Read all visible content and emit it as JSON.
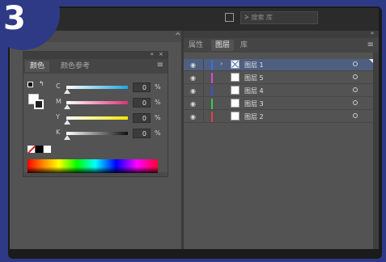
{
  "step_badge": "3",
  "toolbar": {
    "search_placeholder": "ᗒ 搜索 库"
  },
  "left_panel": {
    "collapse_glyph": "^"
  },
  "color_panel": {
    "header_buttons": "« ×",
    "tabs": [
      {
        "label": "颜色",
        "active": true
      },
      {
        "label": "颜色参考",
        "active": false
      }
    ],
    "menu_glyph": "≡",
    "swap_glyph": "↰",
    "sliders": [
      {
        "label": "C",
        "value": "0",
        "unit": "%",
        "fraction": 0.0,
        "color_from": "#ffffff",
        "color_to": "#1ea6e0"
      },
      {
        "label": "M",
        "value": "0",
        "unit": "%",
        "fraction": 0.0,
        "color_from": "#ffffff",
        "color_to": "#e0307a"
      },
      {
        "label": "Y",
        "value": "0",
        "unit": "%",
        "fraction": 0.0,
        "color_from": "#ffffff",
        "color_to": "#f2e600"
      },
      {
        "label": "K",
        "value": "0",
        "unit": "%",
        "fraction": 0.0,
        "color_from": "#ffffff",
        "color_to": "#111111"
      }
    ]
  },
  "layers_panel": {
    "collapse_glyph": "»",
    "tabs": [
      {
        "label": "属性"
      },
      {
        "label": "图层",
        "active": true
      },
      {
        "label": "库"
      }
    ],
    "menu_glyph": "≡",
    "layers": [
      {
        "name": "图层 1",
        "color": "#3b6fd8",
        "selected": true,
        "expanded": true
      },
      {
        "name": "图层 5",
        "color": "#d94ad1",
        "selected": false,
        "expanded": false
      },
      {
        "name": "图层 4",
        "color": "#3d4fd6",
        "selected": false,
        "expanded": false
      },
      {
        "name": "图层 3",
        "color": "#2fd14a",
        "selected": false,
        "expanded": false
      },
      {
        "name": "图层 2",
        "color": "#e0404a",
        "selected": false,
        "expanded": false
      }
    ],
    "eye_glyph": "◉",
    "chevron_glyph": "›"
  }
}
